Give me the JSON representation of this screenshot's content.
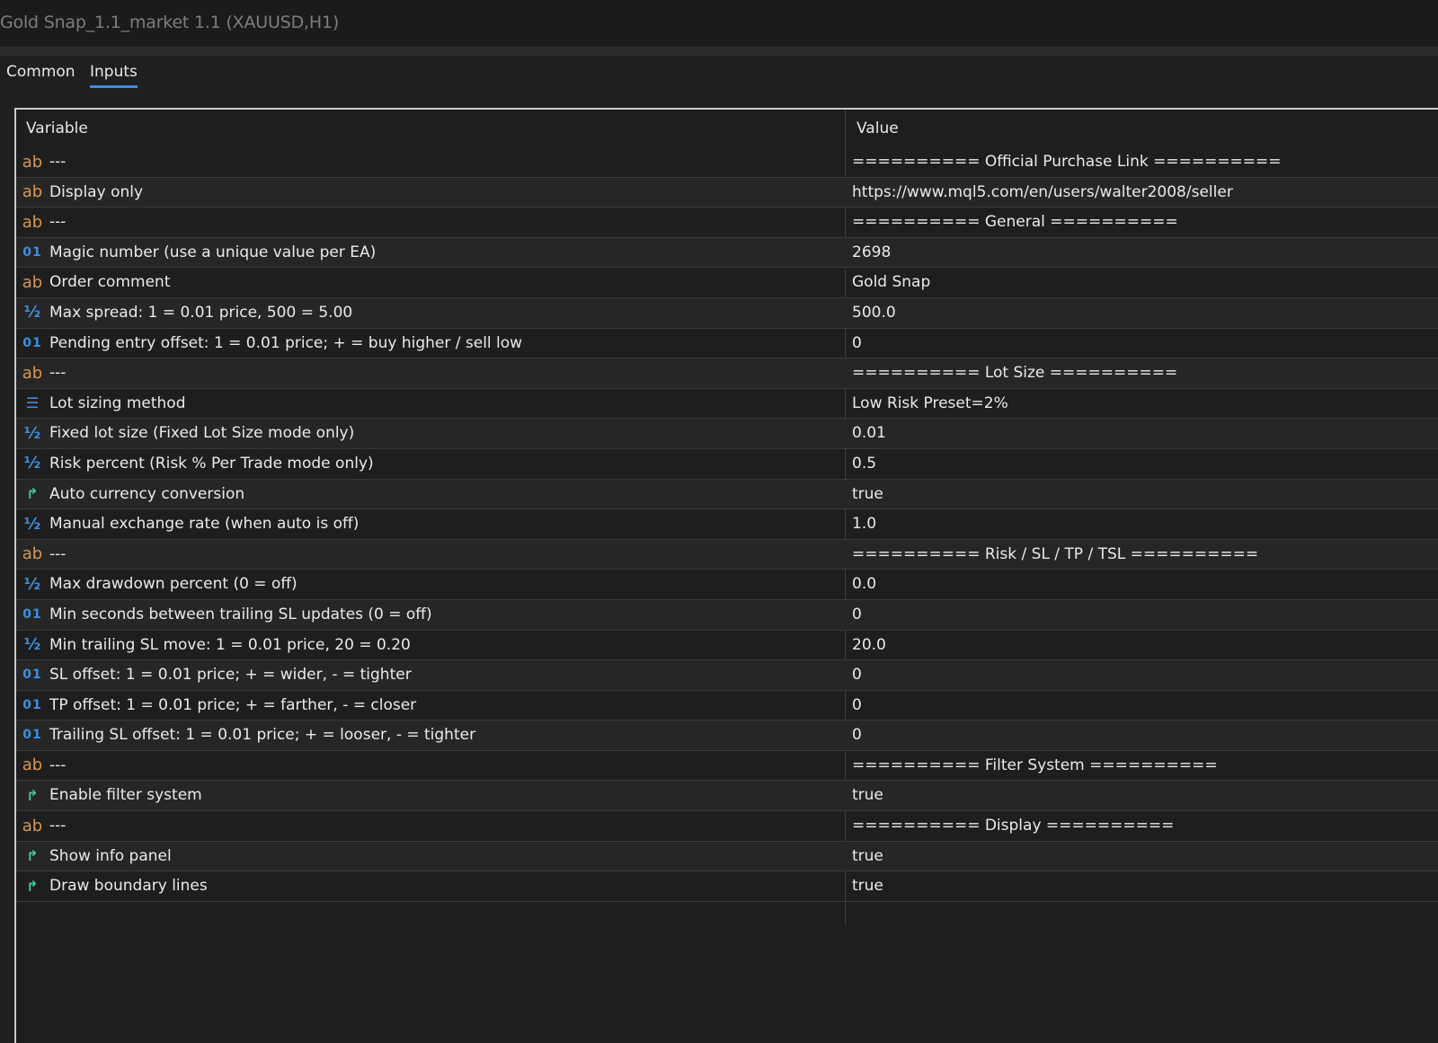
{
  "window": {
    "title": "Gold Snap_1.1_market 1.1 (XAUUSD,H1)"
  },
  "tabs": [
    {
      "label": "Common"
    },
    {
      "label": "Inputs"
    }
  ],
  "table": {
    "headers": {
      "variable": "Variable",
      "value": "Value"
    },
    "rows": [
      {
        "type": "string",
        "icon": "ab",
        "variable": "---",
        "value": "========== Official Purchase Link =========="
      },
      {
        "type": "string",
        "icon": "ab",
        "variable": "Display only",
        "value": "https://www.mql5.com/en/users/walter2008/seller"
      },
      {
        "type": "string",
        "icon": "ab",
        "variable": "---",
        "value": "========== General =========="
      },
      {
        "type": "int",
        "icon": "01",
        "variable": "Magic number (use a unique value per EA)",
        "value": "2698"
      },
      {
        "type": "string",
        "icon": "ab",
        "variable": "Order comment",
        "value": "Gold Snap"
      },
      {
        "type": "double",
        "icon": "½",
        "variable": "Max spread: 1 = 0.01 price, 500 = 5.00",
        "value": "500.0"
      },
      {
        "type": "int",
        "icon": "01",
        "variable": "Pending entry offset: 1 = 0.01 price; + = buy higher / sell low",
        "value": "0"
      },
      {
        "type": "string",
        "icon": "ab",
        "variable": "---",
        "value": "========== Lot Size =========="
      },
      {
        "type": "enum",
        "icon": "☰",
        "variable": "Lot sizing method",
        "value": "Low Risk Preset=2%"
      },
      {
        "type": "double",
        "icon": "½",
        "variable": "Fixed lot size (Fixed Lot Size mode only)",
        "value": "0.01"
      },
      {
        "type": "double",
        "icon": "½",
        "variable": "Risk percent (Risk % Per Trade mode only)",
        "value": "0.5"
      },
      {
        "type": "bool",
        "icon": "↱",
        "variable": "Auto currency conversion",
        "value": "true"
      },
      {
        "type": "double",
        "icon": "½",
        "variable": "Manual exchange rate (when auto is off)",
        "value": "1.0"
      },
      {
        "type": "string",
        "icon": "ab",
        "variable": "---",
        "value": "========== Risk / SL / TP / TSL =========="
      },
      {
        "type": "double",
        "icon": "½",
        "variable": "Max drawdown percent (0 = off)",
        "value": "0.0"
      },
      {
        "type": "int",
        "icon": "01",
        "variable": "Min seconds between trailing SL updates (0 = off)",
        "value": "0"
      },
      {
        "type": "double",
        "icon": "½",
        "variable": "Min trailing SL move: 1 = 0.01 price, 20 = 0.20",
        "value": "20.0"
      },
      {
        "type": "int",
        "icon": "01",
        "variable": "SL offset: 1 = 0.01 price; + = wider, - = tighter",
        "value": "0"
      },
      {
        "type": "int",
        "icon": "01",
        "variable": "TP offset: 1 = 0.01 price; + = farther, - = closer",
        "value": "0"
      },
      {
        "type": "int",
        "icon": "01",
        "variable": "Trailing SL offset: 1 = 0.01 price; + = looser, - = tighter",
        "value": "0"
      },
      {
        "type": "string",
        "icon": "ab",
        "variable": "---",
        "value": "========== Filter System =========="
      },
      {
        "type": "bool",
        "icon": "↱",
        "variable": "Enable filter system",
        "value": "true"
      },
      {
        "type": "string",
        "icon": "ab",
        "variable": "---",
        "value": "========== Display =========="
      },
      {
        "type": "bool",
        "icon": "↱",
        "variable": "Show info panel",
        "value": "true"
      },
      {
        "type": "bool",
        "icon": "↱",
        "variable": "Draw boundary lines",
        "value": "true"
      }
    ]
  },
  "colors": {
    "string_icon": "#d99650",
    "numeric_icon": "#3d8fe0",
    "bool_icon": "#3ec7a2",
    "active_tab_underline": "#3a8ee6"
  }
}
